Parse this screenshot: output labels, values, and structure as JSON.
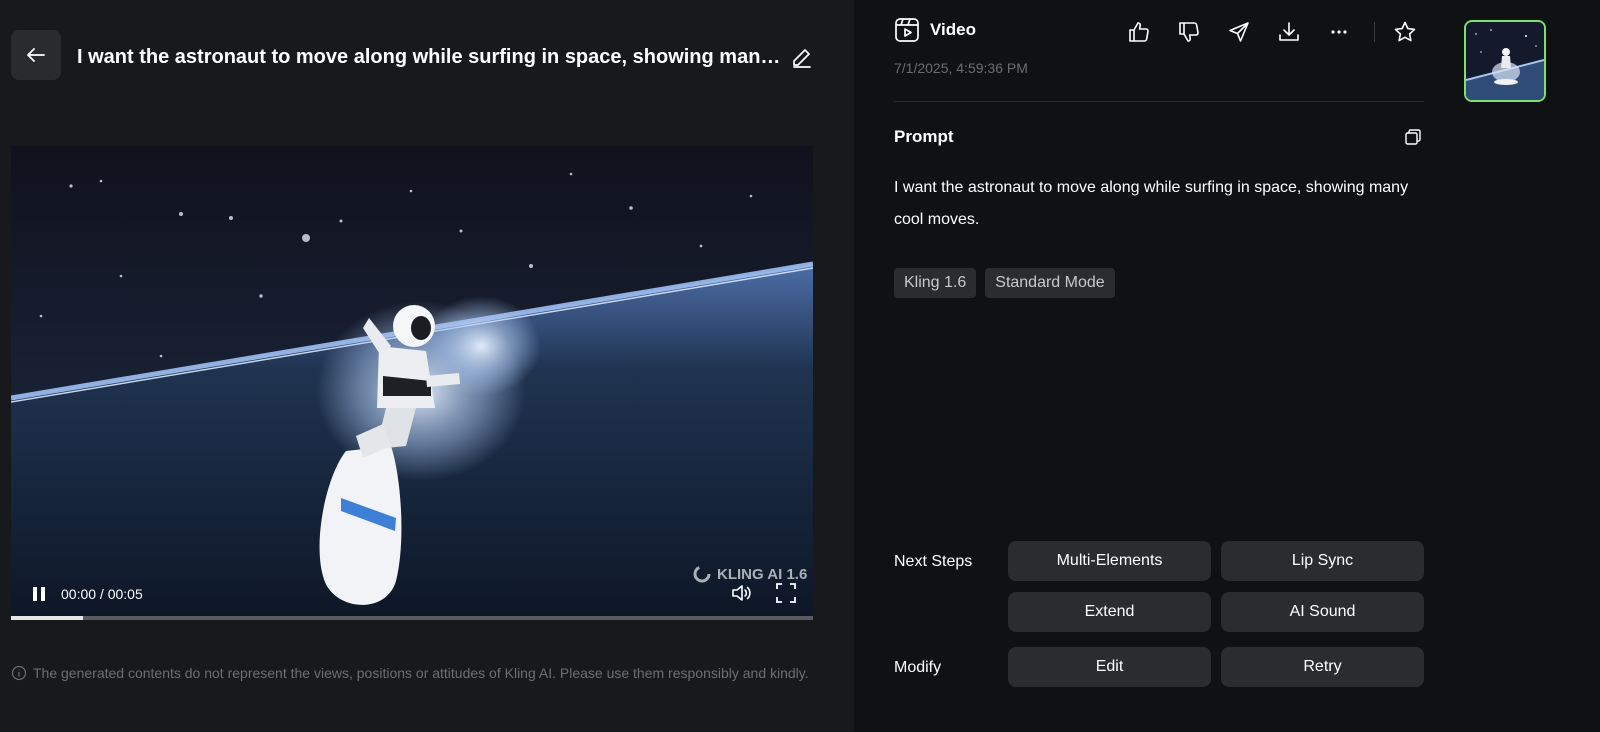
{
  "header": {
    "title": "I want the astronaut to move along while surfing in space, showing many cool moves."
  },
  "player": {
    "time": "00:00 / 00:05",
    "progress": 0.09,
    "watermark": "KLING AI 1.6"
  },
  "disclaimer": "The generated contents do not represent the views, positions or attitudes of Kling AI. Please use them responsibly and kindly.",
  "details": {
    "media_type": "Video",
    "timestamp": "7/1/2025, 4:59:36 PM",
    "prompt_heading": "Prompt",
    "prompt_text": "I want the astronaut to move along while surfing in space, showing many cool moves.",
    "tags": [
      "Kling 1.6",
      "Standard Mode"
    ]
  },
  "next_steps": {
    "label": "Next Steps",
    "buttons": [
      "Multi-Elements",
      "Lip Sync",
      "Extend",
      "AI Sound"
    ]
  },
  "modify": {
    "label": "Modify",
    "buttons": [
      "Edit",
      "Retry"
    ]
  },
  "icons": {
    "back": "arrow-left-icon",
    "edit": "pencil-icon",
    "video": "video-icon",
    "like": "thumbs-up-icon",
    "dislike": "thumbs-down-icon",
    "share": "send-icon",
    "download": "download-icon",
    "more": "more-icon",
    "favorite": "star-icon",
    "copy": "copy-icon",
    "info": "info-icon",
    "pause": "pause-icon",
    "volume": "volume-icon",
    "fullscreen": "fullscreen-icon"
  },
  "colors": {
    "accent_border": "#7ee06d"
  }
}
